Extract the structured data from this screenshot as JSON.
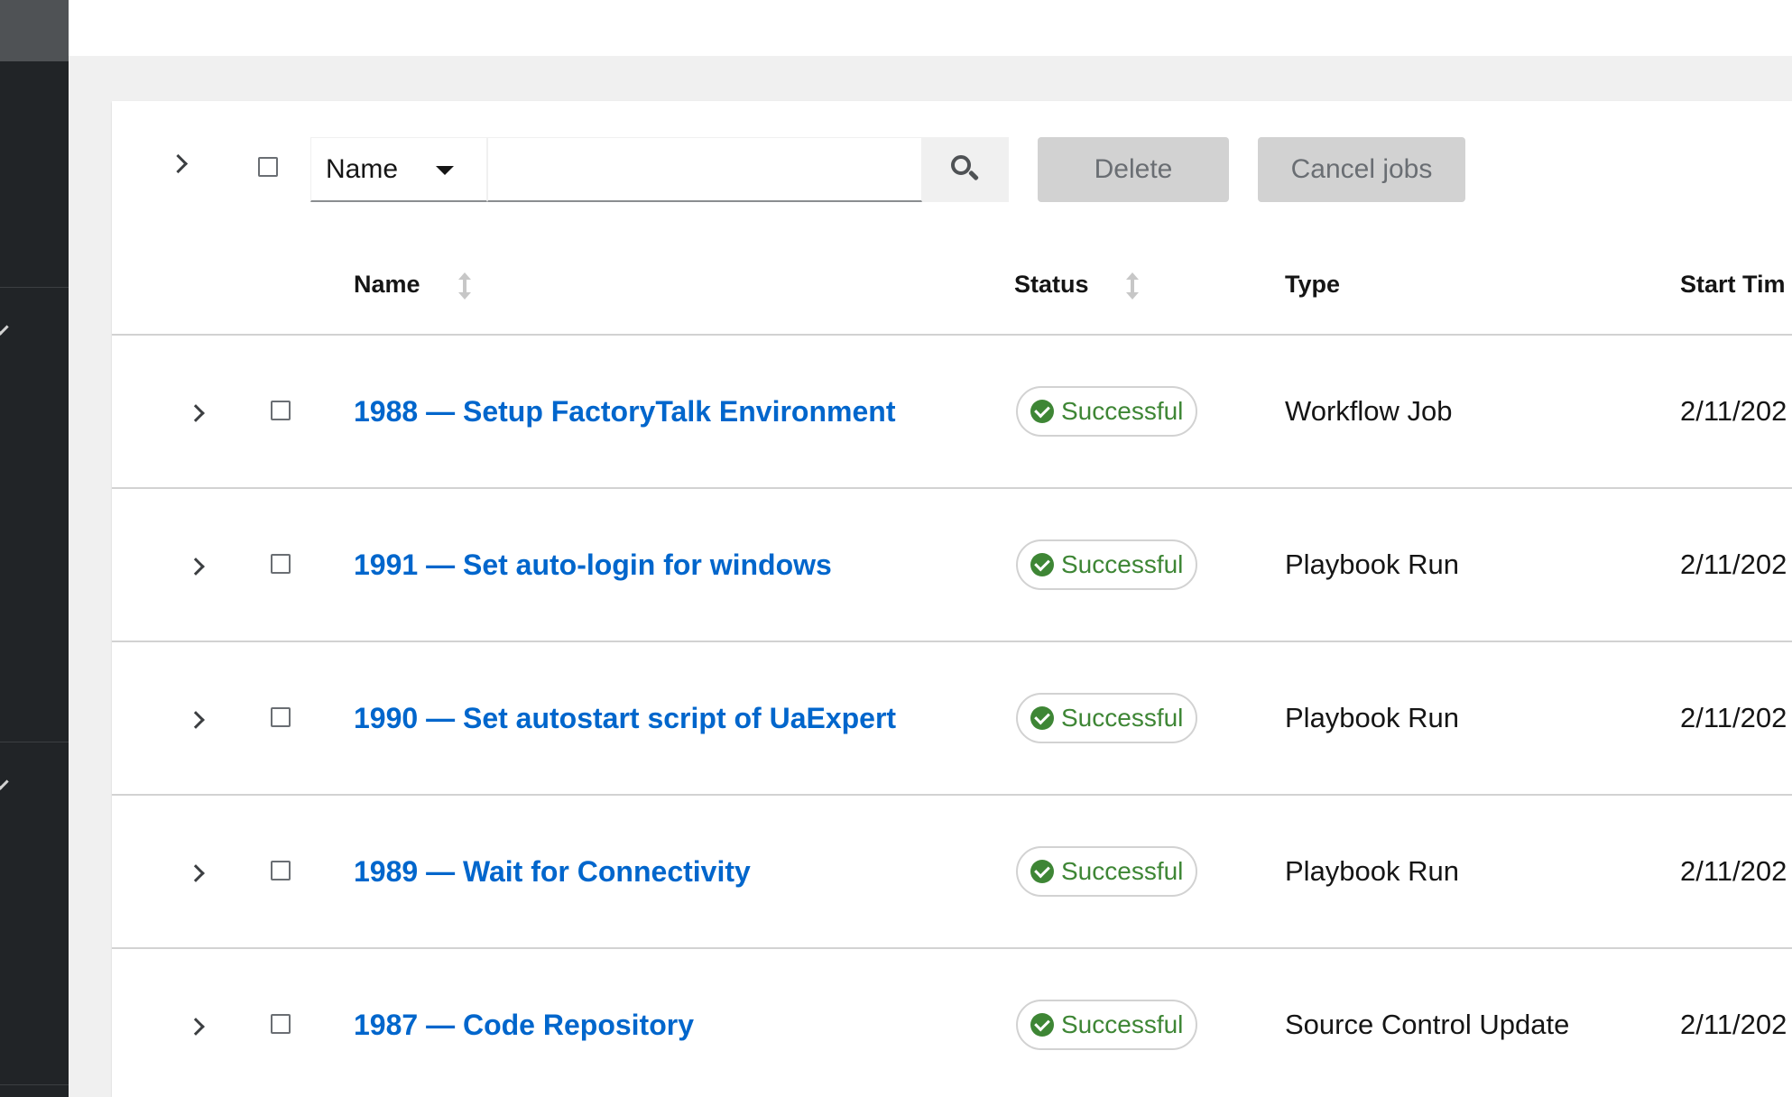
{
  "toolbar": {
    "filter_select_value": "Name",
    "search_placeholder": "",
    "delete_label": "Delete",
    "cancel_jobs_label": "Cancel jobs"
  },
  "table": {
    "columns": {
      "name": "Name",
      "status": "Status",
      "type": "Type",
      "start_time": "Start Tim"
    },
    "rows": [
      {
        "name": "1988 — Setup FactoryTalk Environment",
        "status": "Successful",
        "type": "Workflow Job",
        "start_time": "2/11/202"
      },
      {
        "name": "1991 — Set auto-login for windows",
        "status": "Successful",
        "type": "Playbook Run",
        "start_time": "2/11/202"
      },
      {
        "name": "1990 — Set autostart script of UaExpert",
        "status": "Successful",
        "type": "Playbook Run",
        "start_time": "2/11/202"
      },
      {
        "name": "1989 — Wait for Connectivity",
        "status": "Successful",
        "type": "Playbook Run",
        "start_time": "2/11/202"
      },
      {
        "name": "1987 — Code Repository",
        "status": "Successful",
        "type": "Source Control Update",
        "start_time": "2/11/202"
      }
    ]
  },
  "colors": {
    "link": "#0066cc",
    "success": "#3e8635",
    "nav_bg": "#212427",
    "disabled_button_bg": "#d2d2d2"
  }
}
